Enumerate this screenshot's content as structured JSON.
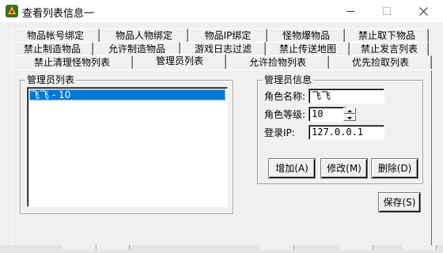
{
  "window": {
    "title": "查看列表信息一"
  },
  "tabs": {
    "row1": [
      "物品帐号绑定",
      "物品人物绑定",
      "物品IP绑定",
      "怪物爆物品",
      "禁止取下物品"
    ],
    "row2": [
      "禁止制造物品",
      "允许制造物品",
      "游戏日志过滤",
      "禁止传送地图",
      "禁止发言列表"
    ],
    "row3": [
      "禁止清理怪物列表",
      "管理员列表",
      "允许捡物列表",
      "优先捡取列表"
    ],
    "active": "管理员列表"
  },
  "admin_list": {
    "group_label": "管理员列表",
    "items": [
      "飞飞 - 10"
    ]
  },
  "admin_info": {
    "group_label": "管理员信息",
    "name_label": "角色名称:",
    "name_value": "飞飞",
    "level_label": "角色等级:",
    "level_value": "10",
    "ip_label": "登录IP:",
    "ip_value": "127.0.0.1"
  },
  "buttons": {
    "add": "增加(A)",
    "modify": "修改(M)",
    "delete": "删除(D)",
    "save": "保存(S)"
  },
  "colors": {
    "selection": "#0078d7",
    "face": "#f0f0f0"
  }
}
